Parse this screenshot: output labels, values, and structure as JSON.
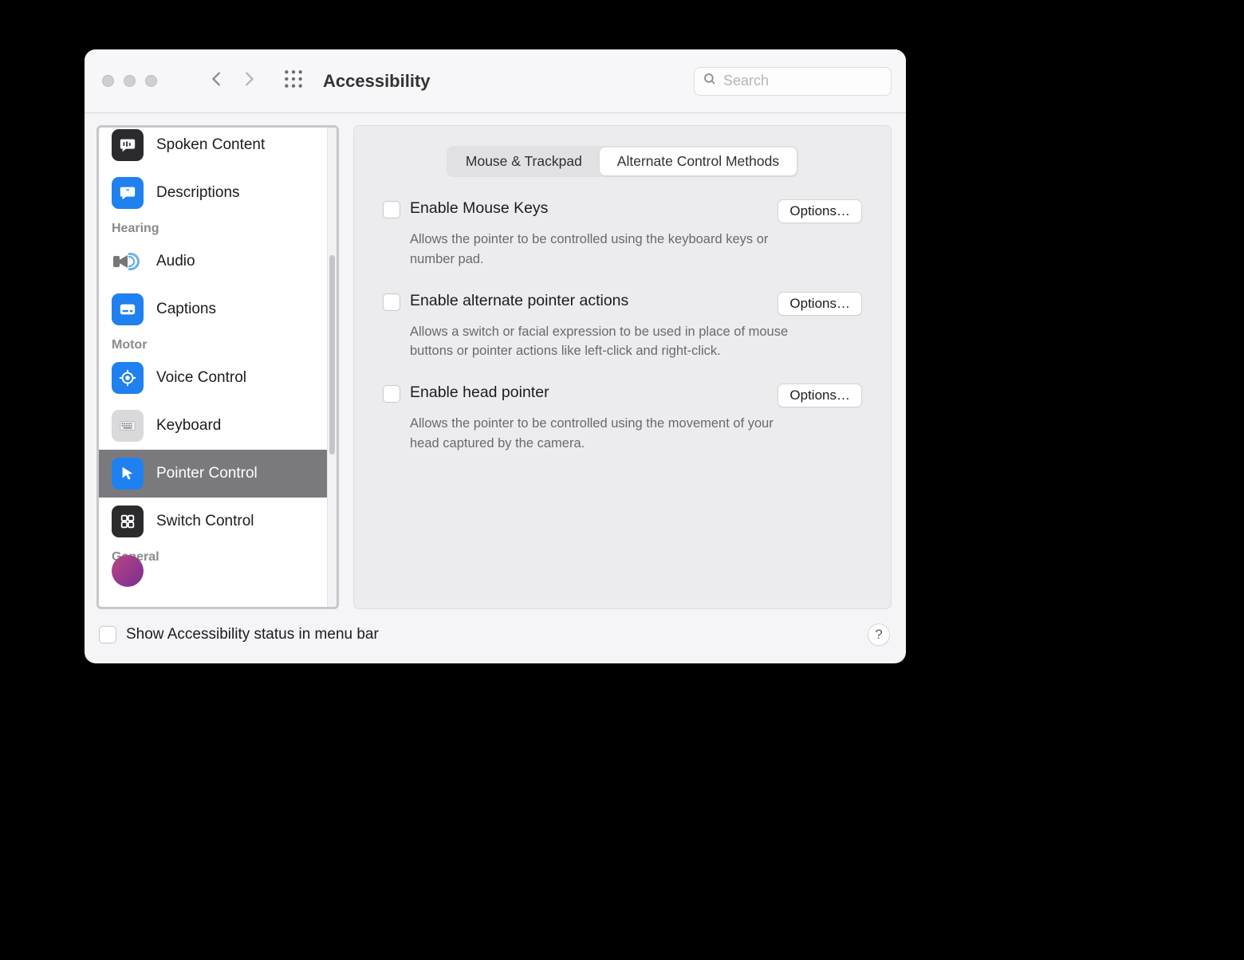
{
  "header": {
    "title": "Accessibility",
    "search_placeholder": "Search"
  },
  "sidebar": {
    "sections": [
      {
        "items": [
          {
            "id": "spoken-content",
            "label": "Spoken Content",
            "icon": "speech-bubble-bars-icon",
            "color": "dark"
          },
          {
            "id": "descriptions",
            "label": "Descriptions",
            "icon": "quote-bubble-icon",
            "color": "blue"
          }
        ]
      },
      {
        "caption": "Hearing",
        "items": [
          {
            "id": "audio",
            "label": "Audio",
            "icon": "speaker-icon",
            "color": "raw"
          },
          {
            "id": "captions",
            "label": "Captions",
            "icon": "caption-bubble-icon",
            "color": "blue"
          }
        ]
      },
      {
        "caption": "Motor",
        "items": [
          {
            "id": "voice-control",
            "label": "Voice Control",
            "icon": "crosshair-icon",
            "color": "blue"
          },
          {
            "id": "keyboard",
            "label": "Keyboard",
            "icon": "keyboard-icon",
            "color": "gray"
          },
          {
            "id": "pointer-control",
            "label": "Pointer Control",
            "icon": "cursor-icon",
            "color": "blue",
            "selected": true
          },
          {
            "id": "switch-control",
            "label": "Switch Control",
            "icon": "grid-icon",
            "color": "dark"
          }
        ]
      },
      {
        "caption": "General",
        "items": []
      }
    ]
  },
  "main": {
    "tabs": [
      {
        "id": "mouse-trackpad",
        "label": "Mouse & Trackpad",
        "active": false
      },
      {
        "id": "alternate-methods",
        "label": "Alternate Control Methods",
        "active": true
      }
    ],
    "settings": [
      {
        "id": "mouse-keys",
        "title": "Enable Mouse Keys",
        "description": "Allows the pointer to be controlled using the keyboard keys or number pad.",
        "options_label": "Options…",
        "checked": false
      },
      {
        "id": "alt-pointer-actions",
        "title": "Enable alternate pointer actions",
        "description": "Allows a switch or facial expression to be used in place of mouse buttons or pointer actions like left-click and right-click.",
        "options_label": "Options…",
        "checked": false
      },
      {
        "id": "head-pointer",
        "title": "Enable head pointer",
        "description": "Allows the pointer to be controlled using the movement of your head captured by the camera.",
        "options_label": "Options…",
        "checked": false
      }
    ]
  },
  "footer": {
    "status_checkbox_label": "Show Accessibility status in menu bar",
    "status_checked": false,
    "help_label": "?"
  }
}
